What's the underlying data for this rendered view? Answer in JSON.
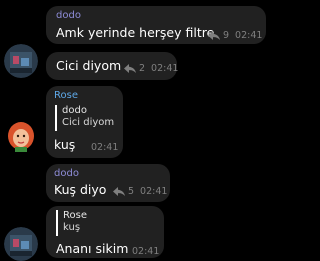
{
  "messages": [
    {
      "sender": "dodo",
      "text": "Amk yerinde herşey filtre",
      "forwards": "9",
      "time": "02:41"
    },
    {
      "text": "Cici diyom",
      "forwards": "2",
      "time": "02:41"
    },
    {
      "sender": "Rose",
      "reply_to": {
        "sender": "dodo",
        "text": "Cici diyom"
      },
      "text": "kuş",
      "time": "02:41"
    },
    {
      "sender": "dodo",
      "text": "Kuş diyo",
      "forwards": "5",
      "time": "02:41"
    },
    {
      "reply_to": {
        "sender": "Rose",
        "text": "kuş"
      },
      "text": "Ananı sikim",
      "time": "02:41"
    }
  ],
  "colors": {
    "background": "#000000",
    "bubble": "#212121",
    "dodo_name": "#8e8dd8",
    "rose_name": "#5ea8e8",
    "meta": "#7f7f7f"
  },
  "icons": {
    "forward": "share-arrow-icon"
  }
}
